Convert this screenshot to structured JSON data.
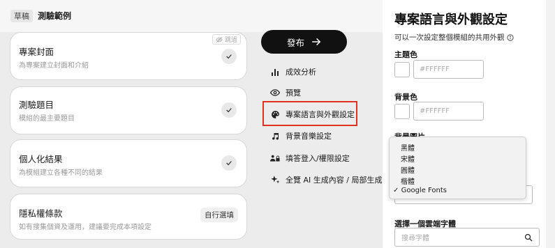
{
  "header": {
    "status": "草稿",
    "title": "測驗範例"
  },
  "cards": [
    {
      "title": "專案封面",
      "subtitle": "為專案建立封面和介紹",
      "skip_label": "跳過"
    },
    {
      "title": "測驗題目",
      "subtitle": "模組的最主要題目"
    },
    {
      "title": "個人化結果",
      "subtitle": "為模組建立各種不同的結果"
    },
    {
      "title": "隱私權條款",
      "subtitle": "如有搜集個資及運用，建議要完成本項設定",
      "badge": "自行選填"
    }
  ],
  "actions": {
    "publish_label": "發布",
    "menu": [
      {
        "label": "成效分析",
        "icon": "bar-chart-icon"
      },
      {
        "label": "預覽",
        "icon": "eye-icon"
      },
      {
        "label": "專案語言與外觀設定",
        "icon": "palette-icon"
      },
      {
        "label": "背景音樂設定",
        "icon": "music-note-icon"
      },
      {
        "label": "填答登入/權限設定",
        "icon": "users-lock-icon"
      },
      {
        "label": "全覽 AI 生成內容 / 局部生成",
        "icon": "sparkle-icon"
      }
    ]
  },
  "panel": {
    "title": "專案語言與外觀設定",
    "description": "可以一次設定整個模組的共用外觀",
    "theme_color": {
      "label": "主題色",
      "placeholder": "#FFFFFF"
    },
    "bg_color": {
      "label": "背景色",
      "placeholder": "#FFFFFF"
    },
    "bg_image_label": "背景圖片",
    "font_dropdown": {
      "options": [
        "黑體",
        "宋體",
        "圓體",
        "楷體",
        "Google Fonts"
      ],
      "selected": "Google Fonts",
      "checkmark": "✓"
    },
    "cloud_font": {
      "label": "選擇一個雲端字體",
      "placeholder": "搜尋字體"
    }
  },
  "colors": {
    "highlight": "#e0321e",
    "publish_bg": "#111111"
  }
}
